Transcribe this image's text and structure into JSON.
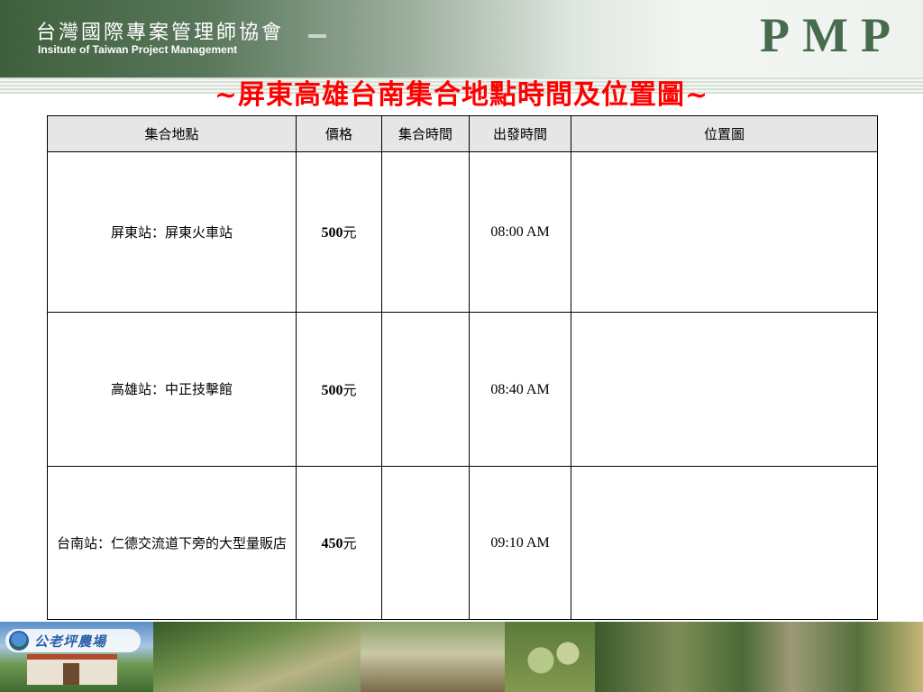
{
  "header": {
    "org_name_zh": "台灣國際專案管理師協會",
    "org_name_en": "Insitute of Taiwan Project Management",
    "logo_text": "PMP"
  },
  "title": "~屏東高雄台南集合地點時間及位置圖~",
  "table": {
    "headers": [
      "集合地點",
      "價格",
      "集合時間",
      "出發時間",
      "位置圖"
    ],
    "rows": [
      {
        "location": "屏東站：屏東火車站",
        "price": "500",
        "price_unit": "元",
        "gather_time": "",
        "depart_time": "08:00 AM",
        "map": ""
      },
      {
        "location": "高雄站：中正技擊館",
        "price": "500",
        "price_unit": "元",
        "gather_time": "",
        "depart_time": "08:40 AM",
        "map": ""
      },
      {
        "location": "台南站：仁德交流道下旁的大型量販店",
        "price": "450",
        "price_unit": "元",
        "gather_time": "",
        "depart_time": "09:10 AM",
        "map": ""
      }
    ]
  },
  "footer": {
    "badge_text": "公老坪農場",
    "icon": "farm-logo-icon"
  },
  "colors": {
    "title": "#ff0000",
    "header_green": "#3f5f3c",
    "logo_green": "#476b4d",
    "table_header_bg": "#e6e6e6"
  }
}
